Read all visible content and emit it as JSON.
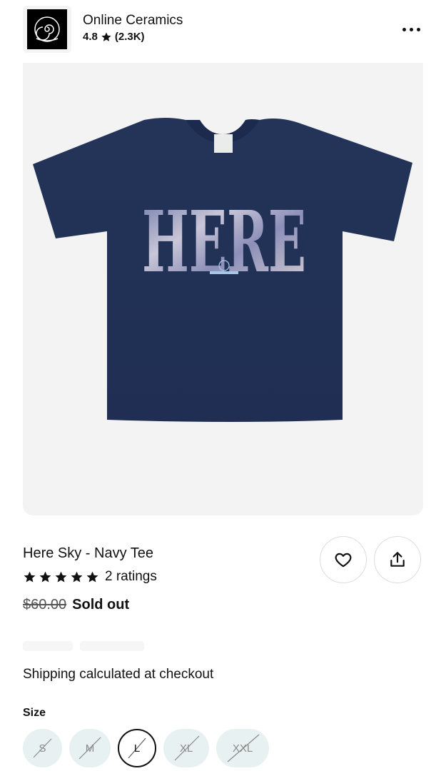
{
  "shop": {
    "name": "Online Ceramics",
    "rating": "4.8",
    "reviews": "(2.3K)"
  },
  "product": {
    "title": "Here Sky - Navy Tee",
    "ratings_text": "2 ratings",
    "star_count": 5,
    "old_price": "$60.00",
    "status": "Sold out",
    "shirt_text": "HERE",
    "shipping": "Shipping calculated at checkout"
  },
  "size": {
    "label": "Size",
    "options": [
      "S",
      "M",
      "L",
      "XL",
      "XXL"
    ],
    "selected": "L"
  },
  "colors": {
    "navy": "#243459",
    "accent_chip": "#e8f1f2",
    "text": "#111111"
  },
  "icons": {
    "more": "more-horizontal-icon",
    "heart": "heart-icon",
    "share": "share-icon",
    "star": "star-icon"
  }
}
